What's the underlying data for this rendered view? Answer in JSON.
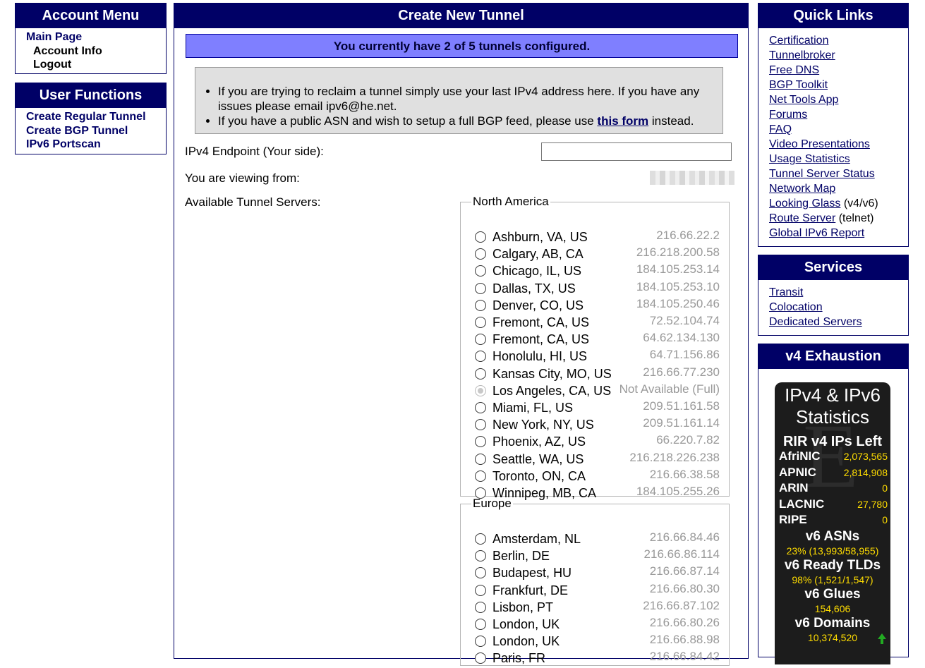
{
  "account_menu": {
    "title": "Account Menu",
    "items": [
      "Main Page",
      "Account Info",
      "Logout"
    ]
  },
  "user_functions": {
    "title": "User Functions",
    "items": [
      "Create Regular Tunnel",
      "Create BGP Tunnel",
      "IPv6 Portscan"
    ]
  },
  "main": {
    "title": "Create New Tunnel",
    "notice": "You currently have 2 of 5 tunnels configured.",
    "info_1": "If you are trying to reclaim a tunnel simply use your last IPv4 address here. If you have any issues please email ipv6@he.net.",
    "info_2_before": "If you have a public ASN and wish to setup a full BGP feed, please use ",
    "info_2_link": "this form",
    "info_2_after": " instead.",
    "ipv4_label": "IPv4 Endpoint (Your side):",
    "ipv4_value": "",
    "viewing_label": "You are viewing from:",
    "servers_label": "Available Tunnel Servers:",
    "regions": [
      {
        "name": "North America",
        "servers": [
          {
            "city": "Ashburn, VA, US",
            "ip": "216.66.22.2"
          },
          {
            "city": "Calgary, AB, CA",
            "ip": "216.218.200.58"
          },
          {
            "city": "Chicago, IL, US",
            "ip": "184.105.253.14"
          },
          {
            "city": "Dallas, TX, US",
            "ip": "184.105.253.10"
          },
          {
            "city": "Denver, CO, US",
            "ip": "184.105.250.46"
          },
          {
            "city": "Fremont, CA, US",
            "ip": "72.52.104.74"
          },
          {
            "city": "Fremont, CA, US",
            "ip": "64.62.134.130"
          },
          {
            "city": "Honolulu, HI, US",
            "ip": "64.71.156.86"
          },
          {
            "city": "Kansas City, MO, US",
            "ip": "216.66.77.230"
          },
          {
            "city": "Los Angeles, CA, US",
            "ip": "Not Available (Full)",
            "disabled": true
          },
          {
            "city": "Miami, FL, US",
            "ip": "209.51.161.58"
          },
          {
            "city": "New York, NY, US",
            "ip": "209.51.161.14"
          },
          {
            "city": "Phoenix, AZ, US",
            "ip": "66.220.7.82"
          },
          {
            "city": "Seattle, WA, US",
            "ip": "216.218.226.238"
          },
          {
            "city": "Toronto, ON, CA",
            "ip": "216.66.38.58"
          },
          {
            "city": "Winnipeg, MB, CA",
            "ip": "184.105.255.26"
          }
        ]
      },
      {
        "name": "Europe",
        "servers": [
          {
            "city": "Amsterdam, NL",
            "ip": "216.66.84.46"
          },
          {
            "city": "Berlin, DE",
            "ip": "216.66.86.114"
          },
          {
            "city": "Budapest, HU",
            "ip": "216.66.87.14"
          },
          {
            "city": "Frankfurt, DE",
            "ip": "216.66.80.30"
          },
          {
            "city": "Lisbon, PT",
            "ip": "216.66.87.102"
          },
          {
            "city": "London, UK",
            "ip": "216.66.80.26"
          },
          {
            "city": "London, UK",
            "ip": "216.66.88.98"
          },
          {
            "city": "Paris, FR",
            "ip": "216.66.84.42"
          }
        ]
      }
    ]
  },
  "quick_links": {
    "title": "Quick Links",
    "items": [
      {
        "link": "Certification",
        "suffix": ""
      },
      {
        "link": "Tunnelbroker",
        "suffix": ""
      },
      {
        "link": "Free DNS",
        "suffix": ""
      },
      {
        "link": "BGP Toolkit",
        "suffix": ""
      },
      {
        "link": "Net Tools App",
        "suffix": ""
      },
      {
        "link": "Forums",
        "suffix": ""
      },
      {
        "link": "FAQ",
        "suffix": ""
      },
      {
        "link": "Video Presentations",
        "suffix": ""
      },
      {
        "link": "Usage Statistics",
        "suffix": ""
      },
      {
        "link": "Tunnel Server Status",
        "suffix": ""
      },
      {
        "link": "Network Map",
        "suffix": ""
      },
      {
        "link": "Looking Glass",
        "suffix": " (v4/v6)"
      },
      {
        "link": "Route Server",
        "suffix": " (telnet)"
      },
      {
        "link": "Global IPv6 Report",
        "suffix": ""
      }
    ]
  },
  "services": {
    "title": "Services",
    "items": [
      "Transit",
      "Colocation",
      "Dedicated Servers"
    ]
  },
  "v4_exhaustion": {
    "title": "v4 Exhaustion",
    "stats_title_1": "IPv4 & IPv6",
    "stats_title_2": "Statistics",
    "rir_heading": "RIR v4 IPs Left",
    "rirs": [
      {
        "name": "AfriNIC",
        "value": "2,073,565"
      },
      {
        "name": "APNIC",
        "value": "2,814,908"
      },
      {
        "name": "ARIN",
        "value": "0"
      },
      {
        "name": "LACNIC",
        "value": "27,780"
      },
      {
        "name": "RIPE",
        "value": "0"
      }
    ],
    "asn_heading": "v6 ASNs",
    "asn_value": "23% (13,993/58,955)",
    "tld_heading": "v6 Ready TLDs",
    "tld_value": "98% (1,521/1,547)",
    "glue_heading": "v6 Glues",
    "glue_value": "154,606",
    "domain_heading": "v6 Domains",
    "domain_value": "10,374,520",
    "watermark": "E",
    "arrow_icon": "up-arrow-icon",
    "accent_color": "#000066"
  }
}
